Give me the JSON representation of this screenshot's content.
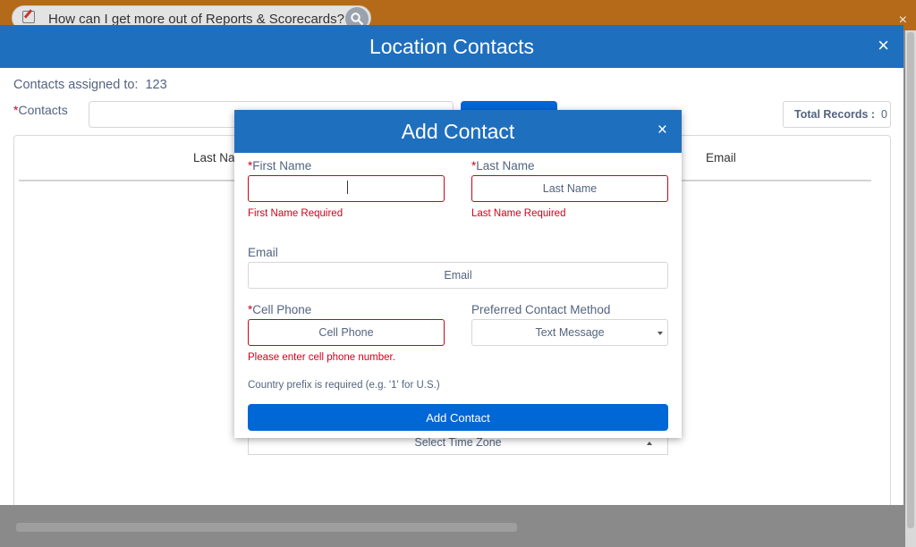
{
  "help_bar": {
    "question": "How can I get more out of Reports & Scorecards?"
  },
  "location_contacts": {
    "title": "Location Contacts",
    "close_glyph": "×",
    "assigned_label": "Contacts assigned to:",
    "assigned_value": "123",
    "contacts_label": "Contacts",
    "required_mark": "*",
    "total_records_label": "Total Records :",
    "total_records_value": "0",
    "columns": [
      "Last Name",
      "Email"
    ],
    "column_last_visible": "Last Nar"
  },
  "add_contact": {
    "title": "Add Contact",
    "close_glyph": "×",
    "first_name": {
      "label": "First Name",
      "value": "",
      "placeholder": "",
      "error": "First Name Required"
    },
    "last_name": {
      "label": "Last Name",
      "value": "",
      "placeholder": "Last Name",
      "error": "Last Name Required"
    },
    "email": {
      "label": "Email",
      "value": "",
      "placeholder": "Email"
    },
    "cell_phone": {
      "label": "Cell Phone",
      "value": "",
      "placeholder": "Cell Phone",
      "error": "Please enter cell phone number."
    },
    "preferred_contact": {
      "label": "Preferred Contact Method",
      "selected": "Text Message"
    },
    "country_note": "Country prefix is required (e.g. '1' for U.S.)",
    "submit_label": "Add Contact",
    "time_zone": {
      "selected": "Select Time Zone"
    }
  },
  "colors": {
    "header_blue": "#1f6fbf",
    "button_blue": "#0067d6",
    "error_red": "#d0021b",
    "label_text": "#536480",
    "top_bar_orange": "#b46a18"
  }
}
